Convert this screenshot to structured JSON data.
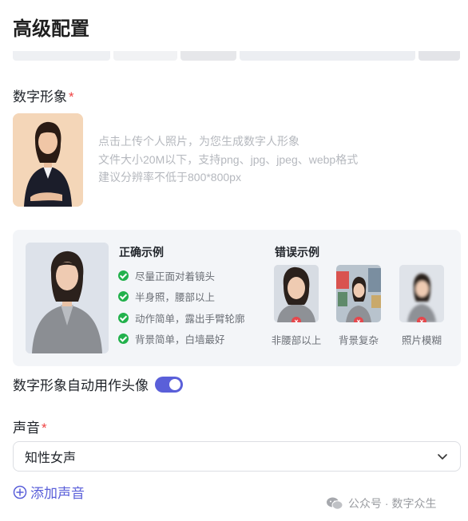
{
  "page": {
    "title": "高级配置"
  },
  "avatar_section": {
    "label": "数字形象",
    "required_mark": "*",
    "upload_hint_lines": [
      "点击上传个人照片，为您生成数字人形象",
      "文件大小20M以下，支持png、jpg、jpeg、webp格式",
      "建议分辨率不低于800*800px"
    ]
  },
  "examples": {
    "correct_title": "正确示例",
    "correct_items": [
      "尽量正面对着镜头",
      "半身照，腰部以上",
      "动作简单，露出手臂轮廓",
      "背景简单，白墙最好"
    ],
    "wrong_title": "错误示例",
    "wrong_items": [
      "非腰部以上",
      "背景复杂",
      "照片模糊"
    ]
  },
  "avatar_toggle": {
    "label": "数字形象自动用作头像",
    "enabled": true
  },
  "voice_section": {
    "label": "声音",
    "required_mark": "*",
    "selected_voice": "知性女声",
    "add_voice_label": "添加声音"
  },
  "watermark": {
    "text": "公众号 · 数字众生"
  },
  "colors": {
    "accent": "#5a5fd9",
    "required": "#ef4444",
    "success": "#22b14c",
    "error": "#e5484d"
  }
}
